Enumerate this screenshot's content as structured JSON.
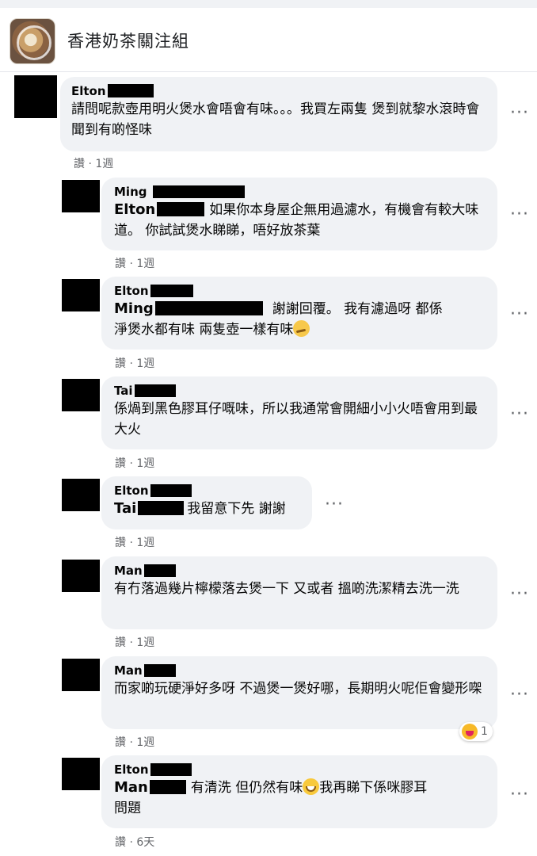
{
  "group": {
    "name": "香港奶茶關注組"
  },
  "meta": {
    "like": "讚",
    "sep": " · "
  },
  "comments": [
    {
      "author": "Elton",
      "mention": "",
      "text": "請問呢款壺用明火煲水會唔會有味。。。我買左兩隻 煲到就黎水滾時會聞到有啲怪味",
      "age": "1週"
    },
    {
      "author": "Ming",
      "mention": "Elton",
      "text": "如果你本身屋企無用過濾水，有機會有較大味道。 你試試煲水睇睇，唔好放茶葉",
      "age": "1週"
    },
    {
      "author": "Elton",
      "mention": "Ming",
      "text_line1": "謝謝回覆。 我有濾過呀 都係",
      "text_line2": "淨煲水都有味 兩隻壺一樣有味",
      "age": "1週",
      "emoji": "thinking-face-icon"
    },
    {
      "author": "Tai",
      "mention": "",
      "text": "係煱到黑色膠耳仔嘅味，所以我通常會開細小小火唔會用到最大火",
      "age": "1週"
    },
    {
      "author": "Elton",
      "mention": "Tai",
      "text": "我留意下先 謝謝",
      "age": "1週"
    },
    {
      "author": "Man",
      "mention": "",
      "text": "有冇落過幾片檸檬落去煲一下 又或者 搵啲洗潔精去洗一洗",
      "age": "1週"
    },
    {
      "author": "Man",
      "mention": "",
      "text": "而家啲玩硬淨好多呀 不過煲一煲好哪，長期明火呢佢會變形㗎",
      "age": "1週",
      "reaction_count": "1"
    },
    {
      "author": "Elton",
      "mention": "Man",
      "text_line1": "有清洗 但仍然有味",
      "text_line1b": "我再睇下係咪膠耳",
      "text_line2": "問題",
      "age": "6天",
      "emoji": "grinning-face-icon"
    }
  ]
}
